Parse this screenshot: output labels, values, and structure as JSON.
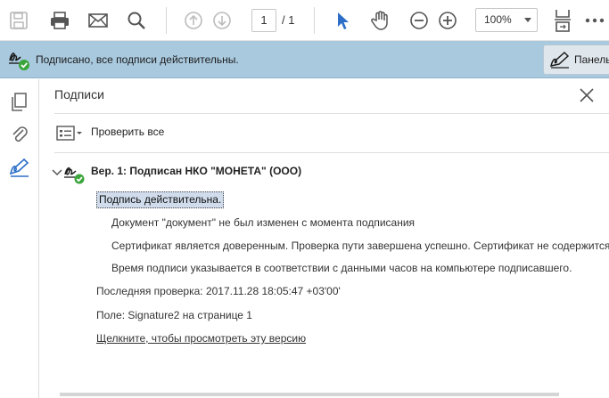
{
  "toolbar": {
    "page_current": "1",
    "page_separator": "/ 1",
    "zoom": "100%",
    "icons": [
      "save-icon",
      "print-icon",
      "email-icon",
      "search-icon",
      "prev-page-icon",
      "next-page-icon",
      "cursor-icon",
      "hand-icon",
      "zoom-out-icon",
      "zoom-in-icon",
      "page-fit-icon",
      "more-icon"
    ],
    "accent": "#2d6fc8"
  },
  "banner": {
    "text": "Подписано, все подписи действительны.",
    "panel_button_label": "Панель",
    "background": "#a9c9de"
  },
  "panel": {
    "title": "Подписи",
    "verify_all": "Проверить все",
    "signature": {
      "title": "Вер. 1: Подписан НКО \"МОНЕТА\" (ООО)",
      "status": "Подпись действительна.",
      "details": [
        "Документ \"документ\" не был изменен с момента подписания",
        "Сертификат является доверенным. Проверка пути завершена успешно. Сертификат не содержится в",
        "Время подписи указывается в соответствии с данными часов на компьютере подписавшего."
      ],
      "last_check": "Последняя проверка: 2017.11.28 18:05:47 +03'00'",
      "field": "Поле: Signature2 на странице 1",
      "view_link": "Щелкните, чтобы просмотреть эту версию"
    }
  }
}
